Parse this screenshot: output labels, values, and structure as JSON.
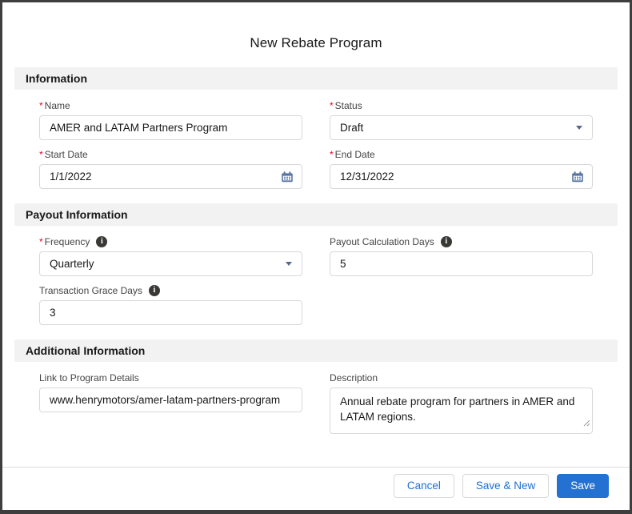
{
  "title": "New Rebate Program",
  "ui": {
    "required_marker": "*"
  },
  "colors": {
    "brand_button": "#2471d2",
    "link_blue": "#1b6fd3",
    "required_red": "#ea001e",
    "icon_slate": "#54698d",
    "section_header_bg": "#f3f2f2"
  },
  "sections": {
    "information": {
      "heading": "Information",
      "fields": {
        "name": {
          "label": "Name",
          "required": true,
          "value": "AMER and LATAM Partners Program"
        },
        "status": {
          "label": "Status",
          "required": true,
          "value": "Draft"
        },
        "start_date": {
          "label": "Start Date",
          "required": true,
          "value": "1/1/2022"
        },
        "end_date": {
          "label": "End Date",
          "required": true,
          "value": "12/31/2022"
        }
      }
    },
    "payout": {
      "heading": "Payout Information",
      "fields": {
        "frequency": {
          "label": "Frequency",
          "required": true,
          "value": "Quarterly",
          "has_info": true
        },
        "payout_calculation_days": {
          "label": "Payout Calculation Days",
          "required": false,
          "value": "5",
          "has_info": true
        },
        "transaction_grace_days": {
          "label": "Transaction Grace Days",
          "required": false,
          "value": "3",
          "has_info": true
        }
      }
    },
    "additional": {
      "heading": "Additional Information",
      "fields": {
        "link_to_program_details": {
          "label": "Link to Program Details",
          "required": false,
          "value": "www.henrymotors/amer-latam-partners-program"
        },
        "description": {
          "label": "Description",
          "required": false,
          "value": "Annual rebate program for partners in AMER and LATAM regions."
        }
      }
    }
  },
  "footer": {
    "cancel_label": "Cancel",
    "save_new_label": "Save & New",
    "save_label": "Save"
  }
}
